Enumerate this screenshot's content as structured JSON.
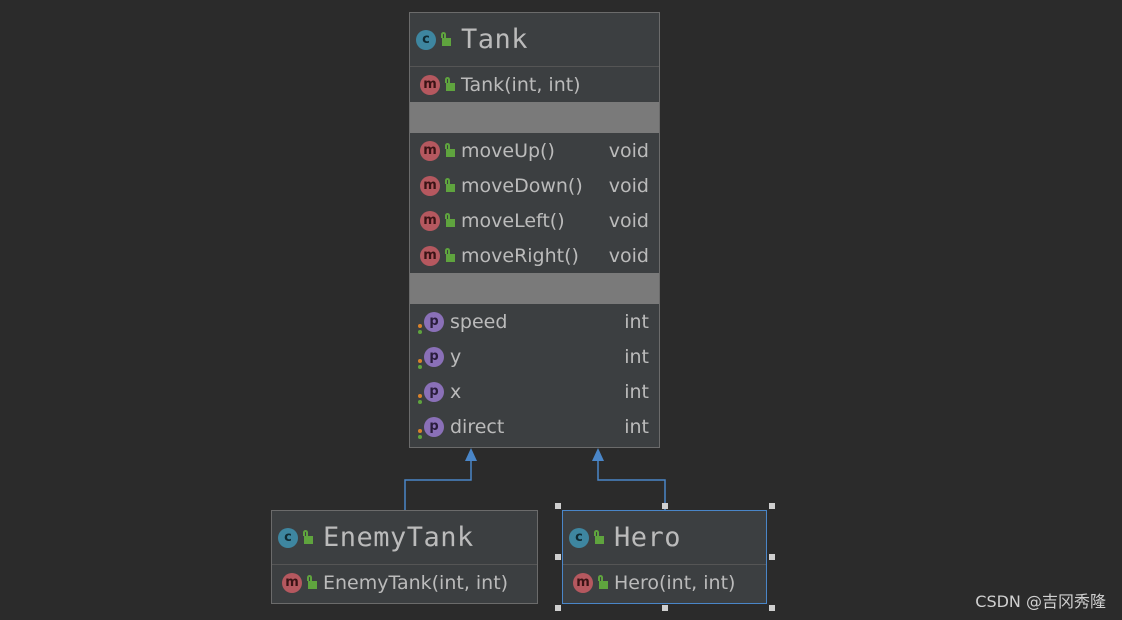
{
  "tank": {
    "title": "Tank",
    "constructor": "Tank(int, int)",
    "methods": [
      {
        "name": "moveUp()",
        "type": "void"
      },
      {
        "name": "moveDown()",
        "type": "void"
      },
      {
        "name": "moveLeft()",
        "type": "void"
      },
      {
        "name": "moveRight()",
        "type": "void"
      }
    ],
    "fields": [
      {
        "name": "speed",
        "type": "int"
      },
      {
        "name": "y",
        "type": "int"
      },
      {
        "name": "x",
        "type": "int"
      },
      {
        "name": "direct",
        "type": "int"
      }
    ]
  },
  "enemy": {
    "title": "EnemyTank",
    "constructor": "EnemyTank(int, int)"
  },
  "hero": {
    "title": "Hero",
    "constructor": "Hero(int, int)"
  },
  "badges": {
    "class": "c",
    "method": "m",
    "property": "p"
  },
  "colors": {
    "background": "#2b2b2b",
    "node": "#3c3f41",
    "edge": "#4a86c8",
    "separator": "#7a7a7a"
  },
  "watermark": "CSDN @吉冈秀隆"
}
